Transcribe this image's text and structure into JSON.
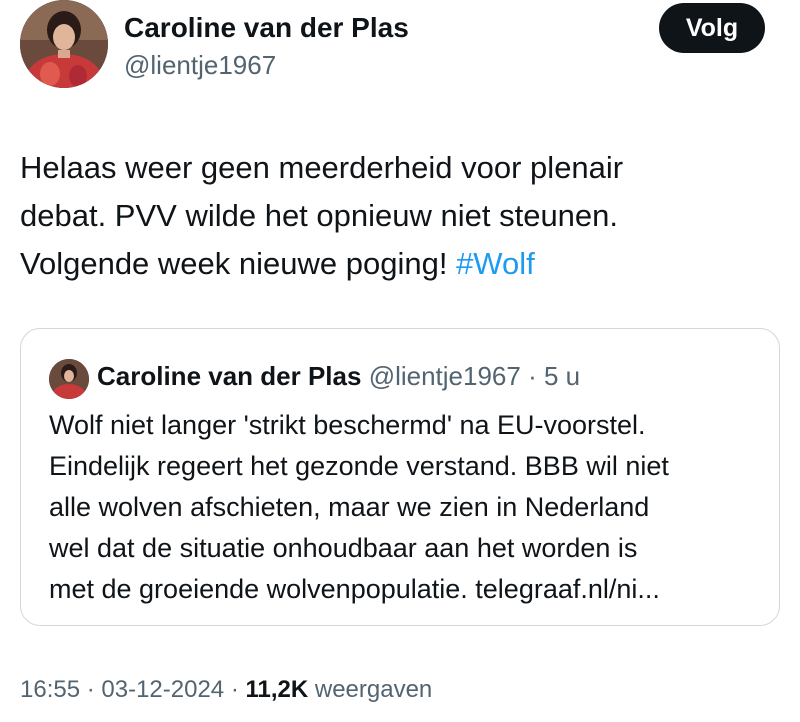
{
  "author": {
    "name": "Caroline van der Plas",
    "handle": "@lientje1967",
    "follow_label": "Volg"
  },
  "tweet": {
    "text_lines": [
      "Helaas weer geen meerderheid voor plenair",
      "debat. PVV wilde het opnieuw niet steunen.",
      "Volgende week nieuwe poging! "
    ],
    "hashtag": "#Wolf"
  },
  "quoted": {
    "name": "Caroline van der Plas",
    "handle": "@lientje1967",
    "separator": " · ",
    "age": "5 u",
    "text_lines": [
      "Wolf niet langer 'strikt beschermd' na EU-voorstel.",
      "Eindelijk regeert het gezonde verstand. BBB wil niet",
      "alle wolven afschieten, maar we zien in Nederland",
      "wel dat de situatie onhoudbaar aan het worden is",
      "met de groeiende wolvenpopulatie. telegraaf.nl/ni..."
    ]
  },
  "footer": {
    "time": "16:55",
    "separator": " · ",
    "date": "03-12-2024",
    "views_count": "11,2K",
    "views_label": " weergaven"
  },
  "colors": {
    "text": "#0f1419",
    "secondary": "#536471",
    "link": "#1d9bf0",
    "button_bg": "#0f1419",
    "border": "#cfd9de"
  }
}
